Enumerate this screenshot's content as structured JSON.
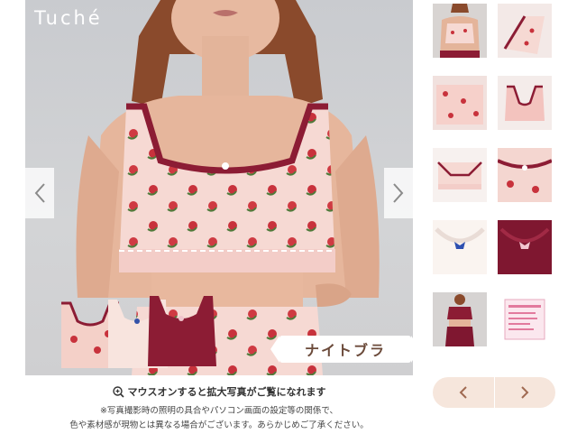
{
  "brand": {
    "name": "Tuché"
  },
  "main_image": {
    "badge_label": "ナイトブラ",
    "prev_icon": "chevron-left-icon",
    "next_icon": "chevron-right-icon"
  },
  "zoom_note": {
    "icon": "zoom-plus-icon",
    "text": "マウスオンすると拡大写真がご覧になれます"
  },
  "disclaimer": {
    "line1": "※写真撮影時の照明の具合やパソコン画面の設定等の関係で、",
    "line2": "色や素材感が現物とは異なる場合がございます。あらかじめご了承ください。"
  },
  "thumbnails": [
    {
      "subject": "model-front"
    },
    {
      "subject": "bra-side-red-trim"
    },
    {
      "subject": "bra-rose-print-flat"
    },
    {
      "subject": "bra-pink-back"
    },
    {
      "subject": "bra-underband-detail"
    },
    {
      "subject": "bra-rose-print-closeup"
    },
    {
      "subject": "neckline-blue-bow"
    },
    {
      "subject": "neckline-burgundy-bow"
    },
    {
      "subject": "model-burgundy-set"
    },
    {
      "subject": "size-tag-label"
    }
  ],
  "thumb_nav": {
    "prev_icon": "chevron-left-icon",
    "next_icon": "chevron-right-icon"
  },
  "colors": {
    "accent_brown": "#a06a52",
    "pill_bg": "#f6e6dc",
    "burgundy": "#8c1c34",
    "pink": "#f3cdc8",
    "rose": "#c8323c"
  }
}
